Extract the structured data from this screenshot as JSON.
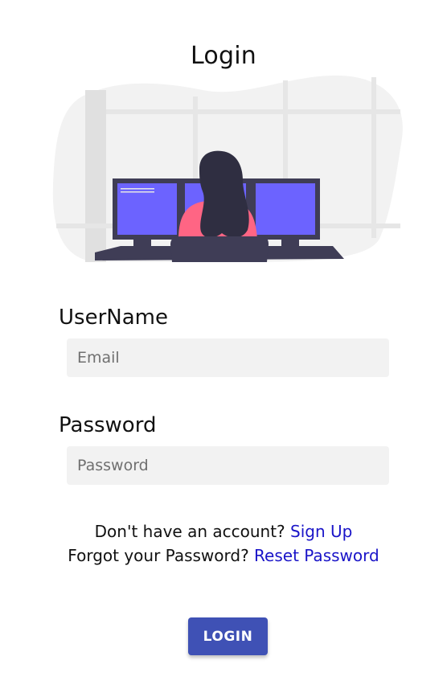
{
  "page": {
    "title": "Login"
  },
  "illustration": {
    "icon": "person-at-computer-illustration",
    "colors": {
      "blob": "#f2f2f2",
      "window_frame": "#e6e6e6",
      "screen": "#6c63ff",
      "monitor_frame": "#3f3d56",
      "shirt": "#ff6584",
      "hair": "#2f2e41",
      "desk": "#3f3d56"
    }
  },
  "form": {
    "username_label": "UserName",
    "email_placeholder": "Email",
    "email_value": "",
    "password_label": "Password",
    "password_placeholder": "Password",
    "password_value": ""
  },
  "links": {
    "signup_prompt": "Don't have an account?",
    "signup_link": "Sign Up",
    "reset_prompt": "Forgot your Password?",
    "reset_link": "Reset Password"
  },
  "actions": {
    "login_label": "LOGIN"
  },
  "colors": {
    "primary_button": "#3f51b5",
    "link": "#1a14c8",
    "input_background": "#f2f2f2"
  }
}
